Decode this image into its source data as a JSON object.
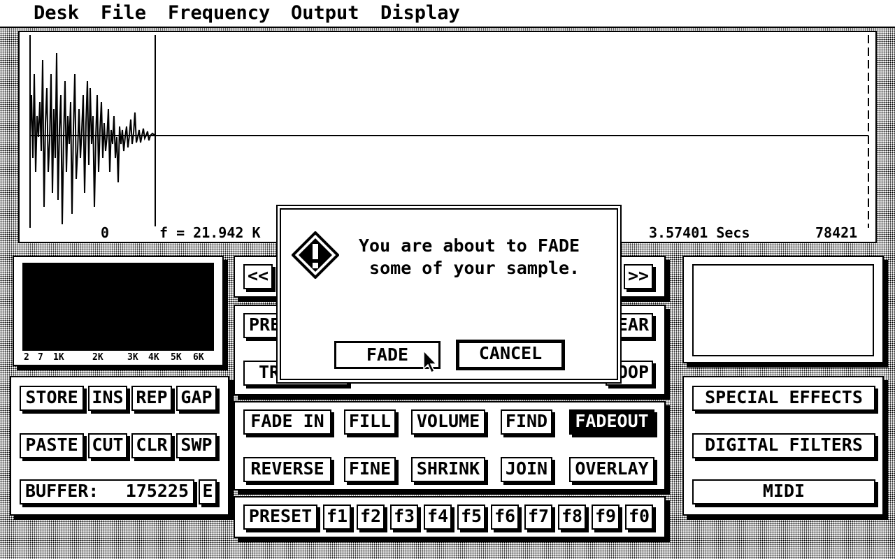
{
  "menu": [
    "Desk",
    "File",
    "Frequency",
    "Output",
    "Display"
  ],
  "waveform": {
    "start_label": "0",
    "freq_label": "f = 21.942 K",
    "duration_label": "3.57401 Secs",
    "length_label": "78421"
  },
  "spectrum": {
    "ticks": [
      "2",
      "7",
      "1K",
      "2K",
      "3K",
      "4K",
      "5K",
      "6K"
    ]
  },
  "nav": {
    "prev_label": "<<",
    "next_label": ">>"
  },
  "transport": {
    "row1_left": "PRE",
    "row1_right": "EAR",
    "row2_left": "TR",
    "row2_right": "OOP"
  },
  "edit_buttons": {
    "row1": [
      "STORE",
      "INS",
      "REP",
      "GAP"
    ],
    "row2": [
      "PASTE",
      "CUT",
      "CLR",
      "SWP"
    ],
    "buffer_label": "BUFFER:",
    "buffer_value": "175225",
    "buffer_e": "E"
  },
  "effects": {
    "row1": [
      "FADE IN",
      "FILL",
      "VOLUME",
      "FIND",
      "FADEOUT"
    ],
    "row2": [
      "REVERSE",
      "FINE",
      "SHRINK",
      "JOIN",
      "OVERLAY"
    ],
    "active": "FADEOUT"
  },
  "presets": {
    "label": "PRESET",
    "keys": [
      "f1",
      "f2",
      "f3",
      "f4",
      "f5",
      "f6",
      "f7",
      "f8",
      "f9",
      "f0"
    ]
  },
  "right_panel": {
    "special_effects": "SPECIAL  EFFECTS",
    "digital_filters": "DIGITAL  FILTERS",
    "midi": "MIDI"
  },
  "dialog": {
    "icon": "warning-icon",
    "line1": "You are about to FADE",
    "line2": " some of your sample.",
    "confirm_label": "FADE",
    "cancel_label": "CANCEL"
  },
  "cursor": "arrow-cursor-icon"
}
